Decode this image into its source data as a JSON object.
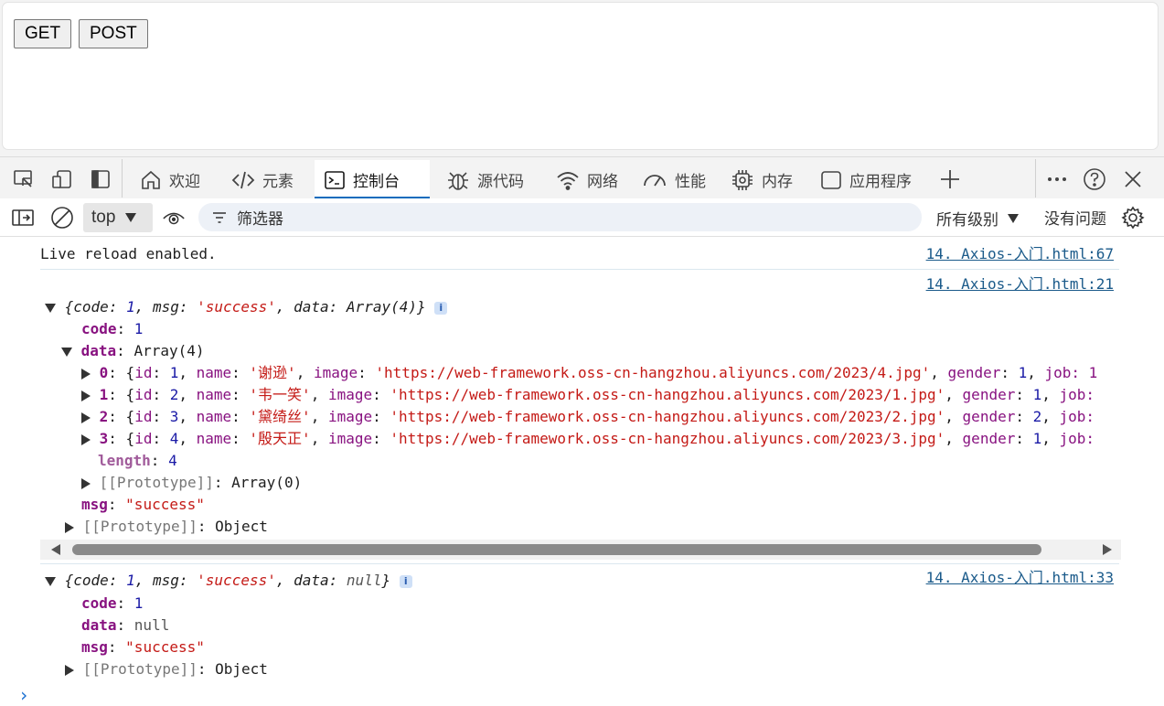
{
  "page": {
    "get_button": "GET",
    "post_button": "POST"
  },
  "devtools": {
    "tabs": [
      {
        "label": "欢迎",
        "icon": "home-icon"
      },
      {
        "label": "元素",
        "icon": "code-icon"
      },
      {
        "label": "控制台",
        "icon": "console-icon",
        "active": true
      },
      {
        "label": "源代码",
        "icon": "bug-icon"
      },
      {
        "label": "网络",
        "icon": "wifi-icon"
      },
      {
        "label": "性能",
        "icon": "gauge-icon"
      },
      {
        "label": "内存",
        "icon": "chip-icon"
      },
      {
        "label": "应用程序",
        "icon": "app-window-icon"
      }
    ],
    "accent": "#0f6cbd",
    "toolbar": {
      "context": "top",
      "filter_placeholder": "筛选器",
      "levels": "所有级别",
      "issues": "没有问题"
    }
  },
  "console": {
    "live_reload": "Live reload enabled.",
    "src_67": "14. Axios-入门.html:67",
    "src_21": "14. Axios-入门.html:21",
    "src_33": "14. Axios-入门.html:33",
    "obj1": {
      "summary_pre": "{",
      "summary_code_key": "code",
      "summary_code_val": "1",
      "summary_msg_key": "msg",
      "summary_msg_val": "'success'",
      "summary_data_key": "data",
      "summary_data_val": "Array(4)",
      "code_key": "code",
      "code_val": "1",
      "data_key": "data",
      "data_val": "Array(4)",
      "items": [
        {
          "index": "0",
          "id": "1",
          "name": "'谢逊'",
          "image": "'https://web-framework.oss-cn-hangzhou.aliyuncs.com/2023/4.jpg'",
          "gender": "1",
          "tail": "job: 1"
        },
        {
          "index": "1",
          "id": "2",
          "name": "'韦一笑'",
          "image": "'https://web-framework.oss-cn-hangzhou.aliyuncs.com/2023/1.jpg'",
          "gender": "1",
          "tail": "job:"
        },
        {
          "index": "2",
          "id": "3",
          "name": "'黛绮丝'",
          "image": "'https://web-framework.oss-cn-hangzhou.aliyuncs.com/2023/2.jpg'",
          "gender": "2",
          "tail": "job:"
        },
        {
          "index": "3",
          "id": "4",
          "name": "'殷天正'",
          "image": "'https://web-framework.oss-cn-hangzhou.aliyuncs.com/2023/3.jpg'",
          "gender": "1",
          "tail": "job:"
        }
      ],
      "length_key": "length",
      "length_val": "4",
      "array_proto": "[[Prototype]]",
      "array_proto_val": "Array(0)",
      "msg_key": "msg",
      "msg_val": "\"success\"",
      "obj_proto": "[[Prototype]]",
      "obj_proto_val": "Object"
    },
    "obj2": {
      "summary_code_key": "code",
      "summary_code_val": "1",
      "summary_msg_key": "msg",
      "summary_msg_val": "'success'",
      "summary_data_key": "data",
      "summary_data_val": "null",
      "code_key": "code",
      "code_val": "1",
      "data_key": "data",
      "data_val": "null",
      "msg_key": "msg",
      "msg_val": "\"success\"",
      "obj_proto": "[[Prototype]]",
      "obj_proto_val": "Object"
    },
    "prompt": "›"
  }
}
